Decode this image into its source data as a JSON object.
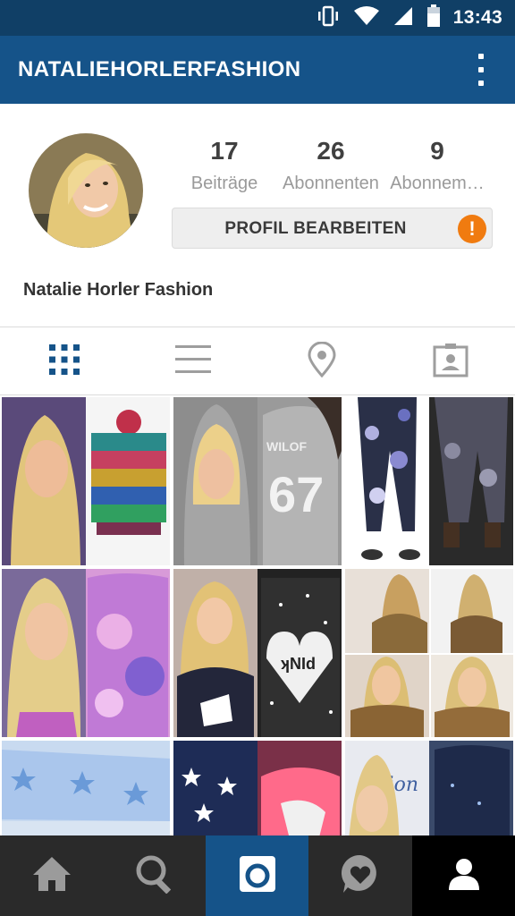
{
  "status_bar": {
    "time": "13:43",
    "icons": [
      "vibrate-icon",
      "wifi-icon",
      "signal-icon",
      "battery-icon"
    ]
  },
  "app_bar": {
    "title": "NATALIEHORLERFASHION",
    "menu_icon": "overflow-menu-icon"
  },
  "profile": {
    "name": "Natalie Horler Fashion",
    "stats": [
      {
        "value": "17",
        "label": "Beiträge"
      },
      {
        "value": "26",
        "label": "Abonnenten"
      },
      {
        "value": "9",
        "label": "Abonnem…"
      }
    ],
    "edit_label": "PROFIL BEARBEITEN",
    "alert_glyph": "!",
    "alert_color": "#f07b10"
  },
  "view_tabs": [
    {
      "icon": "grid-icon",
      "active": true
    },
    {
      "icon": "list-icon",
      "active": false
    },
    {
      "icon": "location-pin-icon",
      "active": false
    },
    {
      "icon": "tagged-person-icon",
      "active": false
    }
  ],
  "bottom_nav": [
    {
      "icon": "home-icon",
      "active": false
    },
    {
      "icon": "search-icon",
      "active": false
    },
    {
      "icon": "camera-icon",
      "active": false
    },
    {
      "icon": "activity-heart-icon",
      "active": false
    },
    {
      "icon": "profile-icon",
      "active": true
    }
  ],
  "colors": {
    "status_bar": "#103f66",
    "app_bar": "#155389",
    "accent": "#155389",
    "bottom_nav": "#2a2a2a"
  },
  "posts": [
    "post-1",
    "post-2",
    "post-3",
    "post-4",
    "post-5",
    "post-6",
    "post-7",
    "post-8",
    "post-9"
  ]
}
